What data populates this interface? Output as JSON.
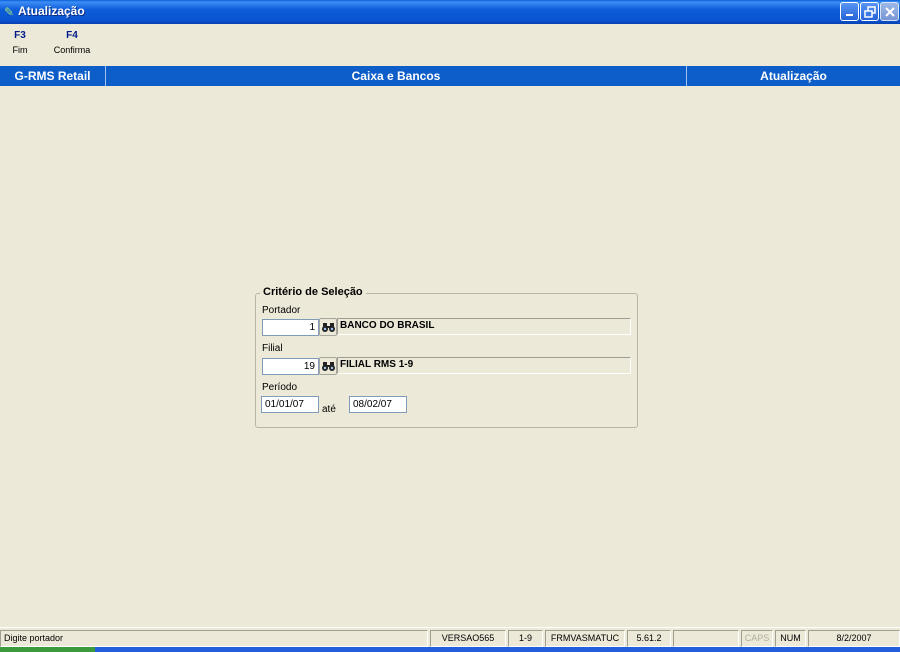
{
  "window": {
    "title": "Atualização",
    "icon": "rms-app-icon"
  },
  "toolbar": {
    "items": [
      {
        "key": "F3",
        "label": "Fim"
      },
      {
        "key": "F4",
        "label": "Confirma"
      }
    ]
  },
  "header": {
    "app": "G-RMS Retail",
    "module": "Caixa e Bancos",
    "screen": "Atualização",
    "color": "#0D5EC9"
  },
  "criteria": {
    "title": "Critério de Seleção",
    "portador": {
      "label": "Portador",
      "code": "1",
      "description": "BANCO DO BRASIL"
    },
    "filial": {
      "label": "Filial",
      "code": "19",
      "description": "FILIAL RMS 1-9"
    },
    "periodo": {
      "label": "Período",
      "from": "01/01/07",
      "separator": "até",
      "to": "08/02/07"
    },
    "lookup_icon": "binoculars-icon"
  },
  "status": {
    "message": "Digite portador",
    "version": "VERSAO565",
    "branch": "1-9",
    "form": "FRMVASMATUC",
    "build": "5.61.2",
    "blank": "",
    "caps": "CAPS",
    "num": "NUM",
    "date": "8/2/2007"
  }
}
